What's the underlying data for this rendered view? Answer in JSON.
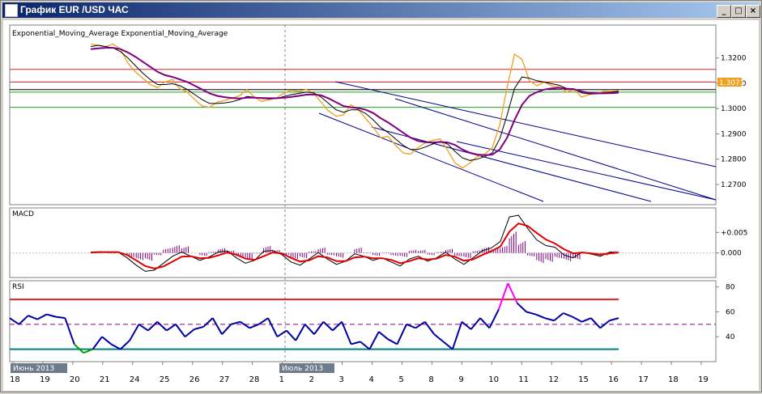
{
  "window": {
    "title": "График EUR /USD ЧАС",
    "buttons": {
      "minimize": "_",
      "maximize": "□",
      "close": "×"
    }
  },
  "price_panel": {
    "indicator_label": "Exponential_Moving_Average Exponential_Moving_Average",
    "current_price_tag": "1.3071"
  },
  "macd_panel": {
    "label": "MACD"
  },
  "rsi_panel": {
    "label": "RSI"
  },
  "x_axis": {
    "labels": [
      "18",
      "19",
      "20",
      "21",
      "24",
      "25",
      "26",
      "27",
      "28",
      "1",
      "2",
      "3",
      "4",
      "5",
      "8",
      "9",
      "10",
      "11",
      "12",
      "15",
      "16",
      "17",
      "18",
      "19"
    ],
    "month_tags": [
      "Июнь 2013",
      "Июль 2013"
    ]
  },
  "colors": {
    "price": "#f0a020",
    "ema_fast": "#000000",
    "ema_slow": "#800080",
    "macd_signal": "#e00000",
    "macd_hist": "#800080",
    "rsi": "#0000a0",
    "rsi_overbought": "#ff00ff",
    "rsi_oversold": "#00a000",
    "level_red": "#e02020",
    "level_green": "#20a020",
    "trend_lines": "#00008b",
    "price_tag_bg": "#f0a020"
  },
  "chart_data": [
    {
      "type": "line",
      "panel": "price",
      "title": "",
      "x_labels": [
        "18",
        "19",
        "20",
        "21",
        "24",
        "25",
        "26",
        "27",
        "28",
        "1",
        "2",
        "3",
        "4",
        "5",
        "8",
        "9",
        "10",
        "11",
        "12",
        "15",
        "16",
        "17",
        "18",
        "19"
      ],
      "y_ticks": [
        1.27,
        1.28,
        1.29,
        1.3,
        1.31,
        1.32
      ],
      "ylim": [
        1.262,
        1.333
      ],
      "series": [
        {
          "name": "",
          "values": [
            1.3255,
            1.325,
            1.3245,
            1.3255,
            1.3235,
            1.318,
            1.3145,
            1.312,
            1.3095,
            1.3082,
            1.3105,
            1.3115,
            1.3078,
            1.3065,
            1.3035,
            1.301,
            1.3005,
            1.3025,
            1.3032,
            1.3042,
            1.305,
            1.3075,
            1.3045,
            1.3028,
            1.3035,
            1.3042,
            1.3062,
            1.3072,
            1.3068,
            1.3075,
            1.306,
            1.3025,
            1.299,
            1.297,
            1.2975,
            1.3015,
            1.2995,
            1.296,
            1.2925,
            1.2885,
            1.289,
            1.2855,
            1.2825,
            1.282,
            1.2845,
            1.2865,
            1.2875,
            1.288,
            1.2835,
            1.2785,
            1.2765,
            1.2785,
            1.281,
            1.282,
            1.2845,
            1.2935,
            1.3085,
            1.3215,
            1.3195,
            1.311,
            1.309,
            1.3105,
            1.309,
            1.3085,
            1.3065,
            1.3075,
            1.3045,
            1.3055,
            1.306,
            1.307,
            1.3068,
            1.3071
          ]
        },
        {
          "name": "",
          "values": [
            1.3245,
            1.325,
            1.3245,
            1.324,
            1.3225,
            1.32,
            1.317,
            1.314,
            1.3115,
            1.3095,
            1.3095,
            1.3098,
            1.309,
            1.3075,
            1.3055,
            1.3035,
            1.302,
            1.302,
            1.3022,
            1.3027,
            1.3035,
            1.3048,
            1.3045,
            1.304,
            1.3038,
            1.304,
            1.3048,
            1.3055,
            1.306,
            1.3065,
            1.3062,
            1.3045,
            1.302,
            1.2995,
            1.2985,
            1.2995,
            1.2995,
            1.298,
            1.2955,
            1.2925,
            1.2905,
            1.288,
            1.2855,
            1.2838,
            1.2838,
            1.2848,
            1.286,
            1.287,
            1.286,
            1.283,
            1.2805,
            1.2795,
            1.28,
            1.281,
            1.2825,
            1.288,
            1.2975,
            1.308,
            1.3125,
            1.312,
            1.311,
            1.3105,
            1.3098,
            1.3092,
            1.308,
            1.3078,
            1.3062,
            1.3058,
            1.3058,
            1.3063,
            1.3065,
            1.3068
          ]
        },
        {
          "name": "",
          "values": [
            1.3235,
            1.3238,
            1.324,
            1.324,
            1.3235,
            1.3222,
            1.3205,
            1.3185,
            1.3165,
            1.3145,
            1.3132,
            1.3125,
            1.3115,
            1.3105,
            1.309,
            1.3075,
            1.306,
            1.305,
            1.3045,
            1.3042,
            1.304,
            1.3043,
            1.3043,
            1.3042,
            1.3041,
            1.3041,
            1.3043,
            1.3046,
            1.305,
            1.3055,
            1.3056,
            1.3052,
            1.304,
            1.3025,
            1.301,
            1.3005,
            1.3002,
            1.2995,
            1.2982,
            1.2962,
            1.2945,
            1.2925,
            1.2905,
            1.2885,
            1.2872,
            1.2867,
            1.2866,
            1.2868,
            1.2866,
            1.2856,
            1.2838,
            1.2825,
            1.2818,
            1.2816,
            1.2818,
            1.2838,
            1.2885,
            1.2955,
            1.3015,
            1.305,
            1.3065,
            1.3075,
            1.308,
            1.3082,
            1.3078,
            1.3076,
            1.3068,
            1.3062,
            1.306,
            1.306,
            1.3061,
            1.3063
          ]
        }
      ],
      "horizontal_levels": [
        1.3155,
        1.3105,
        1.3075,
        1.3065,
        1.3005
      ]
    },
    {
      "type": "line",
      "panel": "macd",
      "title": "",
      "y_ticks": [
        "+0.005",
        "0.000"
      ],
      "ylim": [
        -0.006,
        0.011
      ],
      "series": [
        {
          "name": "",
          "values": [
            0.0002,
            0.0003,
            0.0001,
            0.0002,
            -0.0012,
            -0.003,
            -0.0045,
            -0.0042,
            -0.0025,
            -0.0008,
            0.0002,
            -0.0008,
            -0.0018,
            -0.001,
            0.0002,
            0.0005,
            -0.0012,
            -0.0025,
            -0.0018,
            0.0004,
            0.0006,
            -0.0004,
            -0.0022,
            -0.003,
            -0.0015,
            0.0001,
            -0.0015,
            -0.0028,
            -0.002,
            -0.0002,
            -0.0008,
            -0.0018,
            -0.0012,
            -0.0022,
            -0.0032,
            -0.0015,
            -0.0008,
            -0.002,
            -0.0012,
            0.0002,
            -0.0015,
            -0.0028,
            -0.0012,
            0.0005,
            0.0012,
            0.0028,
            0.0088,
            0.0092,
            0.006,
            0.0032,
            0.0018,
            0.0014,
            -0.0005,
            -0.0012,
            0.0002,
            -0.0003,
            -0.0008,
            0.0002,
            0.0001
          ]
        },
        {
          "name": "",
          "values": [
            0.0001,
            0.0002,
            0.0002,
            0.0002,
            -0.0005,
            -0.0018,
            -0.0032,
            -0.0038,
            -0.0033,
            -0.0021,
            -0.0009,
            -0.0008,
            -0.0013,
            -0.0012,
            -0.0006,
            0.0001,
            -0.0004,
            -0.0014,
            -0.0017,
            -0.0008,
            0.0001,
            -0.0001,
            -0.0012,
            -0.0021,
            -0.0018,
            -0.0008,
            -0.0011,
            -0.002,
            -0.002,
            -0.0011,
            -0.0009,
            -0.0013,
            -0.0013,
            -0.0017,
            -0.0025,
            -0.002,
            -0.0013,
            -0.0016,
            -0.0014,
            -0.0005,
            -0.0009,
            -0.0019,
            -0.0016,
            -0.0005,
            0.0004,
            0.0016,
            0.0052,
            0.0072,
            0.0066,
            0.0049,
            0.0033,
            0.0023,
            0.0009,
            -0.0001,
            0.0001,
            -0.0001,
            -0.0004,
            -0.0001,
            0.0001
          ]
        }
      ]
    },
    {
      "type": "line",
      "panel": "rsi",
      "title": "",
      "y_ticks": [
        40,
        60,
        80
      ],
      "ylim": [
        20,
        85
      ],
      "levels": [
        70,
        30
      ],
      "series": [
        {
          "name": "",
          "values": [
            55,
            50,
            57,
            54,
            58,
            56,
            55,
            34,
            27,
            30,
            40,
            34,
            30,
            37,
            50,
            45,
            52,
            45,
            50,
            40,
            46,
            48,
            55,
            42,
            50,
            52,
            47,
            50,
            55,
            40,
            45,
            37,
            50,
            42,
            52,
            45,
            52,
            34,
            36,
            30,
            44,
            38,
            34,
            50,
            47,
            52,
            42,
            36,
            30,
            52,
            46,
            55,
            47,
            62,
            83,
            67,
            60,
            58,
            55,
            53,
            59,
            56,
            52,
            55,
            47,
            53,
            55
          ]
        }
      ]
    }
  ]
}
